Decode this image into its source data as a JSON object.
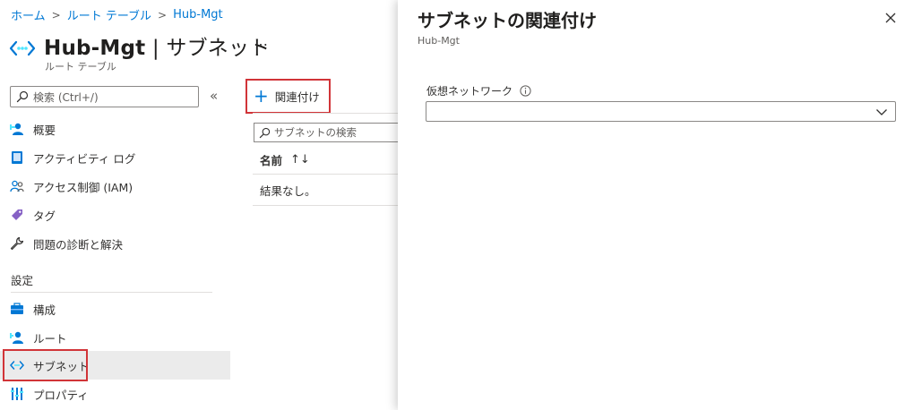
{
  "breadcrumb": {
    "items": [
      "ホーム",
      "ルート テーブル",
      "Hub-Mgt"
    ],
    "separator": ">"
  },
  "header": {
    "title": "Hub-Mgt",
    "title_divider": " | ",
    "title_section": "サブネット",
    "subtitle": "ルート テーブル",
    "more_label": "…",
    "icon": "subnet-icon"
  },
  "sidebar": {
    "search_placeholder": "検索 (Ctrl+/)",
    "collapse_label": "«",
    "items": [
      {
        "label": "概要",
        "icon": "overview-icon"
      },
      {
        "label": "アクティビティ ログ",
        "icon": "activity-log-icon"
      },
      {
        "label": "アクセス制御 (IAM)",
        "icon": "access-control-icon"
      },
      {
        "label": "タグ",
        "icon": "tag-icon"
      },
      {
        "label": "問題の診断と解決",
        "icon": "wrench-icon"
      }
    ],
    "section_label": "設定",
    "settings_items": [
      {
        "label": "構成",
        "icon": "configuration-icon"
      },
      {
        "label": "ルート",
        "icon": "routes-icon"
      },
      {
        "label": "サブネット",
        "icon": "subnet-icon",
        "selected": true
      },
      {
        "label": "プロパティ",
        "icon": "properties-icon"
      }
    ]
  },
  "main": {
    "associate_button": "関連付け",
    "filter_placeholder": "サブネットの検索",
    "column_header": "名前",
    "sort_glyph": "↑↓",
    "empty_message": "結果なし。"
  },
  "panel": {
    "title": "サブネットの関連付け",
    "subtitle": "Hub-Mgt",
    "field_label": "仮想ネットワーク",
    "dropdown_value": ""
  },
  "colors": {
    "accent": "#0078d4",
    "highlight_border": "#d13438",
    "selected_bg": "#ebebeb"
  }
}
